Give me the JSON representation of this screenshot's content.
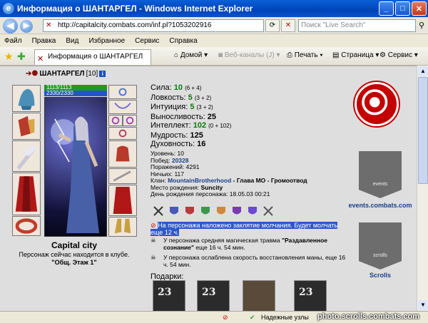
{
  "window": {
    "title": "Информация о ШАНТАРГЕЛ - Windows Internet Explorer",
    "app_icon": "ie-logo-icon",
    "controls": [
      "minimize-icon",
      "maximize-icon",
      "close-icon"
    ]
  },
  "address_bar": {
    "url": "http://capitalcity.combats.com/inf.pl?1053202916",
    "search_placeholder": "Поиск \"Live Search\""
  },
  "menu": [
    "Файл",
    "Правка",
    "Вид",
    "Избранное",
    "Сервис",
    "Справка"
  ],
  "tab": {
    "title": "Информация о ШАНТАРГЕЛ"
  },
  "toolbar": {
    "home": "Домой",
    "feeds": "Веб-каналы (J)",
    "print": "Печать",
    "page": "Страница",
    "tools": "Сервис"
  },
  "character": {
    "name": "ШАНТАРГЕЛ",
    "level_badge": "[10]",
    "hp": "1113/1113",
    "mana": "2330/2330",
    "city": "Capital city",
    "location_line1": "Персонаж сейчас находится в клубе.",
    "location_line2": "\"Общ. Этаж 1\""
  },
  "stats": [
    {
      "label": "Сила: ",
      "value": "10",
      "extra": "(6 + 4)"
    },
    {
      "label": "Ловкость: ",
      "value": "5",
      "extra": "(3 + 2)"
    },
    {
      "label": "Интуиция: ",
      "value": "5",
      "extra": "(3 + 2)"
    },
    {
      "label": "Выносливость: ",
      "value": "25",
      "extra": ""
    },
    {
      "label": "Интеллект: ",
      "value": "102",
      "extra": "(0 + 102)"
    },
    {
      "label": "Мудрость: ",
      "value": "125",
      "extra": ""
    },
    {
      "label": "Духовность: ",
      "value": "16",
      "extra": ""
    }
  ],
  "info": {
    "level": "Уровень: 10",
    "wins_label": "Побед: ",
    "wins": "20328",
    "losses": "Поражений: 4291",
    "draws": "Ничьих: 117",
    "clan_label": "Клан: ",
    "clan": "MountainBrotherhood",
    "clan_role": " - Глава МО - Громоотвод",
    "birthplace_label": "Место рождения: ",
    "birthplace": "Suncity",
    "birthday": "День рождения персонажа: 18.05.03 00:21"
  },
  "effects": {
    "silence": "На персонажа наложено заклятие молчания. Будет молчать еще 12 ч.",
    "trauma_line1": "У персонажа средняя магическая травма ",
    "trauma_name": "\"Раздавленное сознание\"",
    "trauma_line2": " еще 16 ч. 54 мин.",
    "mana_line": "У персонажа ослаблена скорость восстановления маны, еще 16 ч. 54 мин."
  },
  "gifts_label": "Подарки:",
  "gifts": [
    "23",
    "23",
    "",
    "23"
  ],
  "right_panel": {
    "events_banner": "events",
    "events_link": "events.combats.com",
    "scrolls_banner": "scrolls",
    "scrolls_link": "Scrolls"
  },
  "status_bar": {
    "zone": "Надежные узлы"
  },
  "watermark": "photo.scrolls.combats.com",
  "colors": {
    "accent_green": "#0a7a0a",
    "link_blue": "#1a3f8a",
    "selection": "#2d58c6",
    "clan_red": "#c40000"
  }
}
